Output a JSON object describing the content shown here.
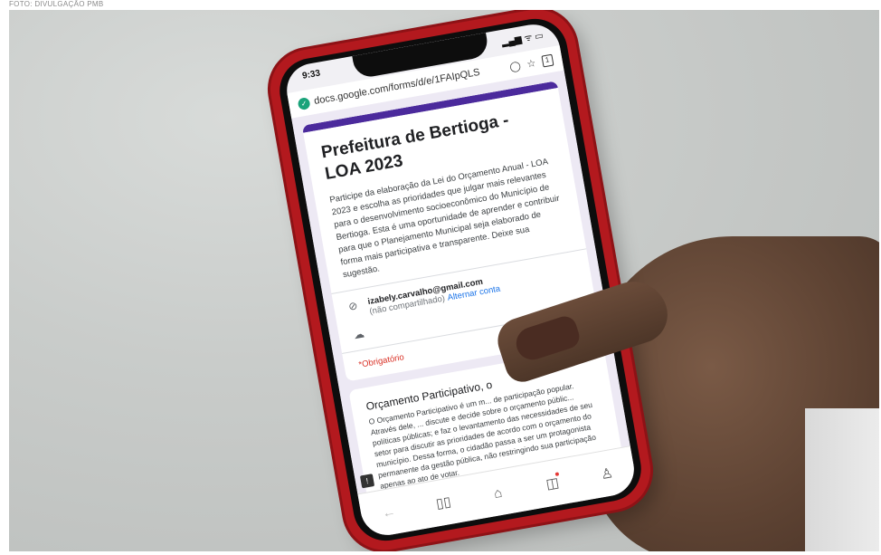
{
  "credit": "FOTO: DIVULGAÇÃO PMB",
  "status": {
    "time": "9:33",
    "icons": "▂▄▆ ᯤ ▭"
  },
  "browser": {
    "url": "docs.google.com/forms/d/e/1FAIpQLS",
    "tab_count": "1"
  },
  "form": {
    "title": "Prefeitura de Bertioga - LOA 2023",
    "description": "Participe da elaboração da Lei do Orçamento Anual - LOA 2023 e escolha as prioridades que julgar mais relevantes para o desenvolvimento socioeconômico do Município de Bertioga. Esta é uma oportunidade de aprender e contribuir para que o Planejamento Municipal seja elaborado de forma mais participativa e transparente. Deixe sua sugestão.",
    "account_email": "izabely.carvalho@gmail.com",
    "not_shared": "(não compartilhado)",
    "switch_account": "Alternar conta",
    "required": "*Obrigatório"
  },
  "section": {
    "title": "Orçamento Participativo, o",
    "description": "O Orçamento Participativo é um m... de participação popular. Através dele, ... discute e decide sobre o orçamento públic... políticas públicas; e faz o levantamento das necessidades de seu setor para discutir as prioridades de acordo com o orçamento do município. Dessa forma, o cidadão passa a ser um protagonista permanente da gestão pública, não restringindo sua participação apenas ao ato de votar."
  },
  "icons": {
    "shield": "shield-icon",
    "eye_off": "eye-off-icon",
    "cloud": "cloud-icon",
    "back": "back-icon",
    "book": "book-icon",
    "home": "home-icon",
    "game": "gamepad-icon",
    "profile": "profile-icon"
  },
  "colors": {
    "phone_case": "#b3191e",
    "form_accent": "#4b2a9c",
    "link": "#1a73e8",
    "required": "#d93025"
  }
}
